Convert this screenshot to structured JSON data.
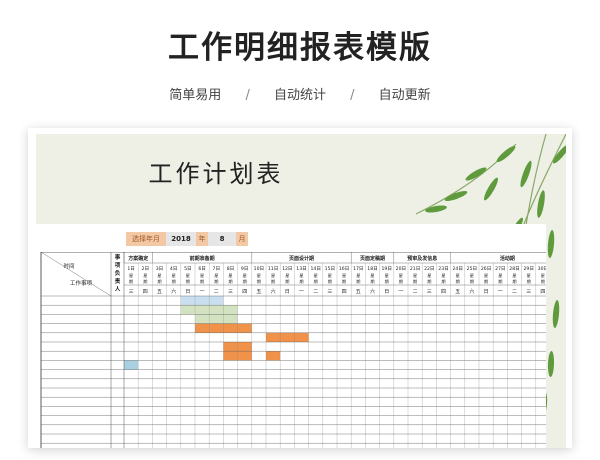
{
  "header": {
    "title": "工作明细报表模版",
    "features": [
      "简单易用",
      "自动统计",
      "自动更新"
    ],
    "separator": "/"
  },
  "poster": {
    "title": "工作计划表"
  },
  "date_select": {
    "label": "选择年月",
    "year": "2018",
    "year_unit": "年",
    "month": "8",
    "month_unit": "月"
  },
  "table": {
    "corner_top": "时间",
    "corner_bottom": "工作事项",
    "owner_header": "事项负责人",
    "phases": [
      {
        "label": "方案确定",
        "span": 2
      },
      {
        "label": "前期准备期",
        "span": 7
      },
      {
        "label": "页面设计期",
        "span": 7
      },
      {
        "label": "页面定稿期",
        "span": 3
      },
      {
        "label": "预审及发信息",
        "span": 4
      },
      {
        "label": "活动期",
        "span": 8
      }
    ],
    "days": [
      "1日",
      "2日",
      "3日",
      "4日",
      "5日",
      "6日",
      "7日",
      "8日",
      "9日",
      "10日",
      "11日",
      "12日",
      "13日",
      "14日",
      "15日",
      "16日",
      "17日",
      "18日",
      "19日",
      "20日",
      "21日",
      "22日",
      "23日",
      "24日",
      "25日",
      "26日",
      "27日",
      "28日",
      "29日",
      "30日",
      "31日"
    ],
    "week_label": "星期",
    "weekdays": [
      "三",
      "四",
      "五",
      "六",
      "日",
      "一",
      "二",
      "三",
      "四",
      "五",
      "六",
      "日",
      "一",
      "二",
      "三",
      "四",
      "五",
      "六",
      "日",
      "一",
      "二",
      "三",
      "四",
      "五",
      "六",
      "日",
      "一",
      "二",
      "三",
      "四",
      "五"
    ],
    "colors": {
      "blue": "#c9dff0",
      "green": "#d3e3c2",
      "orange": "#f0924a",
      "lightblue": "#a8d0e0"
    },
    "bars": [
      {
        "row": 0,
        "start": 5,
        "end": 7,
        "color": "blue"
      },
      {
        "row": 1,
        "start": 5,
        "end": 8,
        "color": "green"
      },
      {
        "row": 2,
        "start": 6,
        "end": 8,
        "color": "green"
      },
      {
        "row": 3,
        "start": 6,
        "end": 9,
        "color": "orange"
      },
      {
        "row": 4,
        "start": 11,
        "end": 13,
        "color": "orange"
      },
      {
        "row": 5,
        "start": 8,
        "end": 9,
        "color": "orange"
      },
      {
        "row": 6,
        "start": 8,
        "end": 9,
        "color": "orange"
      },
      {
        "row": 6,
        "start": 11,
        "end": 11,
        "color": "orange"
      },
      {
        "row": 7,
        "start": 1,
        "end": 1,
        "color": "lightblue"
      }
    ]
  }
}
